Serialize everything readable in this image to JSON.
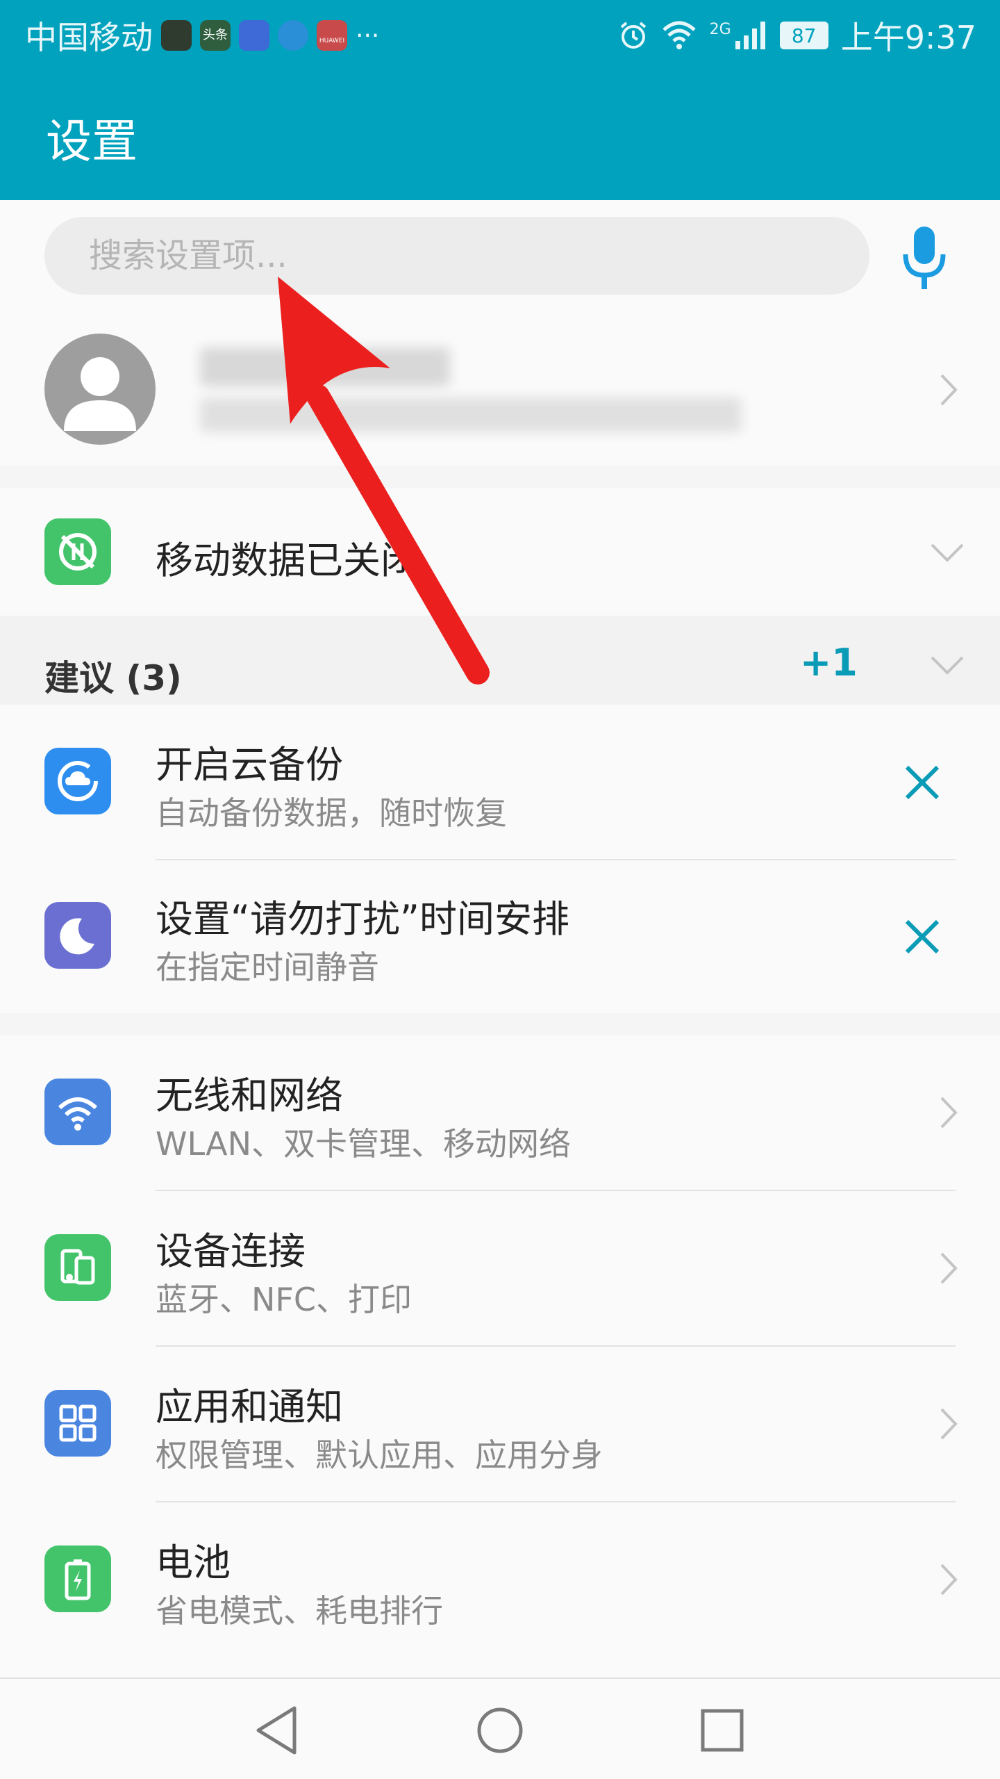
{
  "status_bar": {
    "carrier": "中国移动",
    "notification_apps": [
      {
        "icon": "wechat-video-icon",
        "color": "#2e3b2e"
      },
      {
        "icon": "toutiao-icon",
        "label": "头条",
        "color": "#2f5e3f"
      },
      {
        "icon": "baidu-icon",
        "color": "#3d6ad6"
      },
      {
        "icon": "browser-icon",
        "color": "#2a8fd6"
      },
      {
        "icon": "huawei-store-icon",
        "label": "HUAWEI",
        "color": "#c84a4a"
      }
    ],
    "more": "···",
    "network": "2G",
    "battery": "87",
    "time": "上午9:37"
  },
  "header": {
    "title": "设置"
  },
  "search": {
    "placeholder": "搜索设置项..."
  },
  "mobile_data": {
    "label": "移动数据已关闭"
  },
  "suggestions": {
    "title": "建议 (3)",
    "more_count": "+1",
    "items": [
      {
        "title": "开启云备份",
        "subtitle": "自动备份数据，随时恢复",
        "icon": "cloud-backup-icon",
        "color": "#2d8ef0"
      },
      {
        "title": "设置“请勿打扰”时间安排",
        "subtitle": "在指定时间静音",
        "icon": "moon-icon",
        "color": "#6a6fd1"
      }
    ]
  },
  "settings": [
    {
      "title": "无线和网络",
      "subtitle": "WLAN、双卡管理、移动网络",
      "icon": "wifi-icon",
      "color": "#4a86e0"
    },
    {
      "title": "设备连接",
      "subtitle": "蓝牙、NFC、打印",
      "icon": "device-connection-icon",
      "color": "#43c46b"
    },
    {
      "title": "应用和通知",
      "subtitle": "权限管理、默认应用、应用分身",
      "icon": "apps-grid-icon",
      "color": "#4a86e0"
    },
    {
      "title": "电池",
      "subtitle": "省电模式、耗电排行",
      "icon": "battery-icon",
      "color": "#43c46b"
    }
  ],
  "colors": {
    "accent": "#00a2bd",
    "close_x": "#0a9bb6",
    "mic": "#1b9ce0"
  }
}
